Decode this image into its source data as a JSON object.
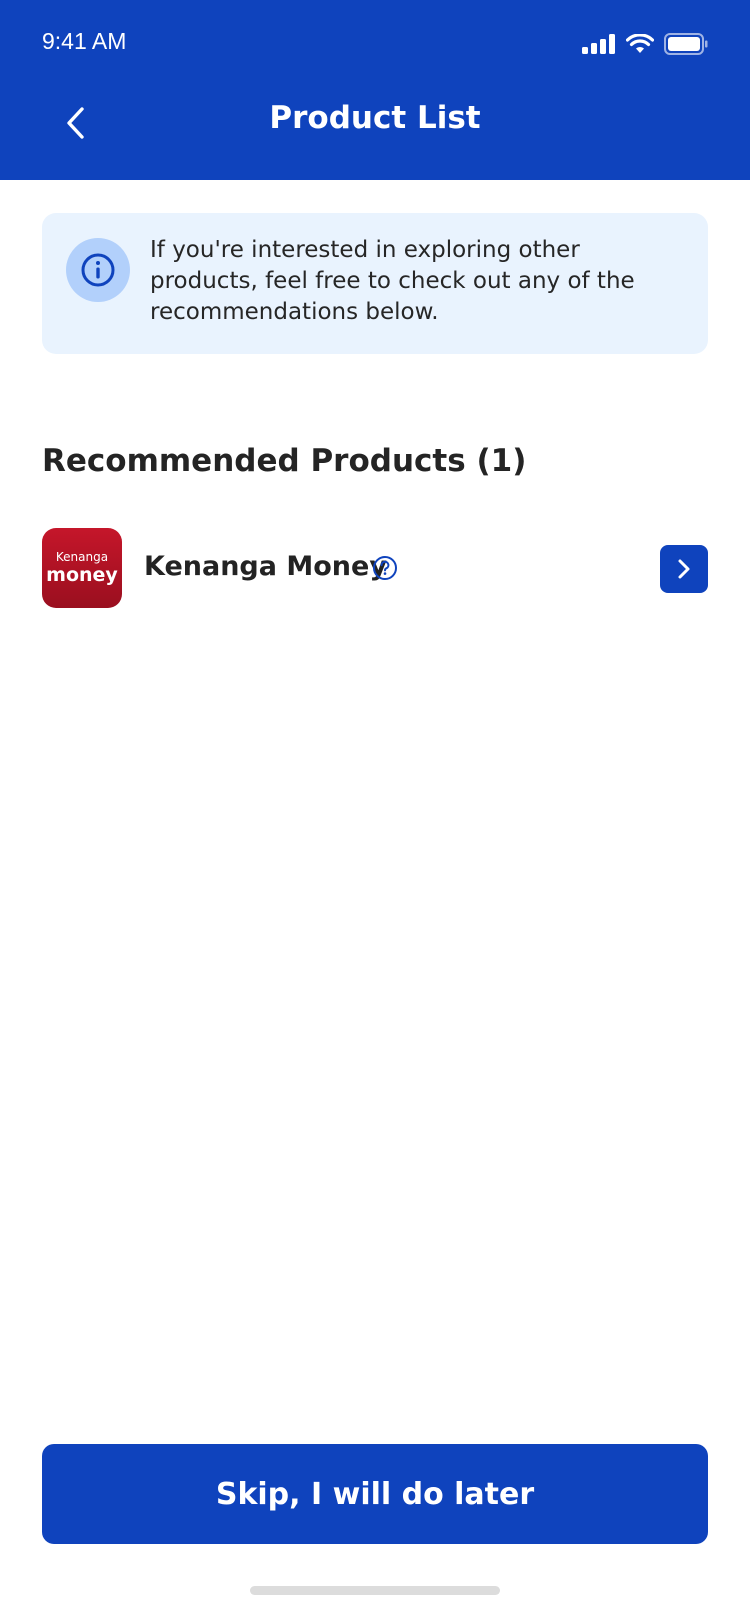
{
  "status_bar": {
    "time": "9:41 AM"
  },
  "header": {
    "title": "Product List",
    "background": "#0f43bd"
  },
  "info_banner": {
    "text": "If you're interested in exploring other products, feel free to check out any of the recommendations below.",
    "icon": "info-icon"
  },
  "section": {
    "title": "Recommended Products (1)"
  },
  "products": [
    {
      "name": "Kenanga Money",
      "logo_top": "Kenanga",
      "logo_bottom": "money",
      "logo_color": "#b3121f",
      "help_icon": "question-circle-icon",
      "action_icon": "chevron-right-icon"
    }
  ],
  "footer": {
    "skip_label": "Skip, I will do later"
  },
  "colors": {
    "primary": "#0f43bd",
    "banner_bg": "#e9f3fe",
    "info_circle": "#b2d0fb"
  }
}
